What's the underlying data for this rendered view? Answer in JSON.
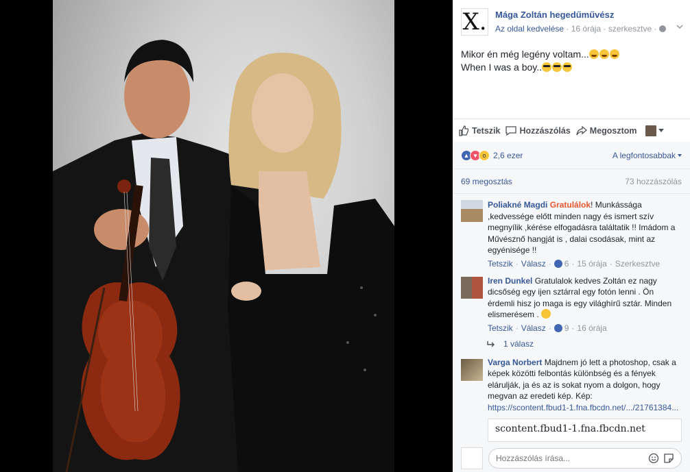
{
  "page": {
    "name": "Mága Zoltán hegedűművész",
    "logo_text": "X.",
    "like_page": "Az oldal kedvelése",
    "time": "16 órája",
    "edited": "szerkesztve",
    "post_text_line1": "Mikor én még legény voltam...",
    "post_text_line2": "When I was a boy.."
  },
  "actions": {
    "like": "Tetszik",
    "comment": "Hozzászólás",
    "share": "Megosztom"
  },
  "reactions": {
    "count": "2,6 ezer",
    "sort": "A legfontosabbak"
  },
  "shares": {
    "shares": "69 megosztás",
    "comments": "73 hozzászólás"
  },
  "comments": [
    {
      "author": "Poliakné Magdi",
      "highlight": "Gratulálok",
      "text": "! Munkássága ,kedvessége előtt minden nagy és ismert szív megnyílik ,kérése elfogadásra találtatik !! Imádom a Művésznő hangját is , dalai csodásak, mint az egyénisége !!",
      "like": "Tetszik",
      "reply": "Válasz",
      "likes": "6",
      "time": "15 órája",
      "edited": "Szerkesztve"
    },
    {
      "author": "Iren Dunkel",
      "text": "Gratulalok kedves Zoltán ez nagy dicsőség egy ijen sztárral egy fotón lenni . Ön érdemli hisz jo maga is egy világhírű sztár. Minden elismerésem .",
      "like": "Tetszik",
      "reply": "Válasz",
      "likes": "9",
      "time": "16 órája",
      "replies": "1 válasz"
    },
    {
      "author": "Varga Norbert",
      "text": "Majdnem jó lett a photoshop, csak a képek közötti felbontás különbség és a fények elárulják, ja és az is sokat nyom a dolgon, hogy megvan az eredeti kép. Kép:",
      "link": "https://scontent.fbud1-1.fna.fbcdn.net/.../21761384...",
      "preview": "scontent.fbud1-1.fna.fbcdn.net"
    }
  ],
  "composer": {
    "placeholder": "Hozzászólás írása..."
  }
}
